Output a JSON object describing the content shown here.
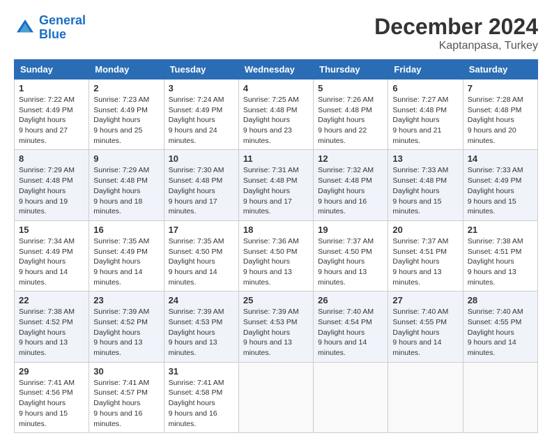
{
  "header": {
    "logo_line1": "General",
    "logo_line2": "Blue",
    "month_year": "December 2024",
    "location": "Kaptanpasa, Turkey"
  },
  "days_of_week": [
    "Sunday",
    "Monday",
    "Tuesday",
    "Wednesday",
    "Thursday",
    "Friday",
    "Saturday"
  ],
  "weeks": [
    [
      {
        "day": "1",
        "sunrise": "7:22 AM",
        "sunset": "4:49 PM",
        "daylight": "9 hours and 27 minutes."
      },
      {
        "day": "2",
        "sunrise": "7:23 AM",
        "sunset": "4:49 PM",
        "daylight": "9 hours and 25 minutes."
      },
      {
        "day": "3",
        "sunrise": "7:24 AM",
        "sunset": "4:49 PM",
        "daylight": "9 hours and 24 minutes."
      },
      {
        "day": "4",
        "sunrise": "7:25 AM",
        "sunset": "4:48 PM",
        "daylight": "9 hours and 23 minutes."
      },
      {
        "day": "5",
        "sunrise": "7:26 AM",
        "sunset": "4:48 PM",
        "daylight": "9 hours and 22 minutes."
      },
      {
        "day": "6",
        "sunrise": "7:27 AM",
        "sunset": "4:48 PM",
        "daylight": "9 hours and 21 minutes."
      },
      {
        "day": "7",
        "sunrise": "7:28 AM",
        "sunset": "4:48 PM",
        "daylight": "9 hours and 20 minutes."
      }
    ],
    [
      {
        "day": "8",
        "sunrise": "7:29 AM",
        "sunset": "4:48 PM",
        "daylight": "9 hours and 19 minutes."
      },
      {
        "day": "9",
        "sunrise": "7:29 AM",
        "sunset": "4:48 PM",
        "daylight": "9 hours and 18 minutes."
      },
      {
        "day": "10",
        "sunrise": "7:30 AM",
        "sunset": "4:48 PM",
        "daylight": "9 hours and 17 minutes."
      },
      {
        "day": "11",
        "sunrise": "7:31 AM",
        "sunset": "4:48 PM",
        "daylight": "9 hours and 17 minutes."
      },
      {
        "day": "12",
        "sunrise": "7:32 AM",
        "sunset": "4:48 PM",
        "daylight": "9 hours and 16 minutes."
      },
      {
        "day": "13",
        "sunrise": "7:33 AM",
        "sunset": "4:48 PM",
        "daylight": "9 hours and 15 minutes."
      },
      {
        "day": "14",
        "sunrise": "7:33 AM",
        "sunset": "4:49 PM",
        "daylight": "9 hours and 15 minutes."
      }
    ],
    [
      {
        "day": "15",
        "sunrise": "7:34 AM",
        "sunset": "4:49 PM",
        "daylight": "9 hours and 14 minutes."
      },
      {
        "day": "16",
        "sunrise": "7:35 AM",
        "sunset": "4:49 PM",
        "daylight": "9 hours and 14 minutes."
      },
      {
        "day": "17",
        "sunrise": "7:35 AM",
        "sunset": "4:50 PM",
        "daylight": "9 hours and 14 minutes."
      },
      {
        "day": "18",
        "sunrise": "7:36 AM",
        "sunset": "4:50 PM",
        "daylight": "9 hours and 13 minutes."
      },
      {
        "day": "19",
        "sunrise": "7:37 AM",
        "sunset": "4:50 PM",
        "daylight": "9 hours and 13 minutes."
      },
      {
        "day": "20",
        "sunrise": "7:37 AM",
        "sunset": "4:51 PM",
        "daylight": "9 hours and 13 minutes."
      },
      {
        "day": "21",
        "sunrise": "7:38 AM",
        "sunset": "4:51 PM",
        "daylight": "9 hours and 13 minutes."
      }
    ],
    [
      {
        "day": "22",
        "sunrise": "7:38 AM",
        "sunset": "4:52 PM",
        "daylight": "9 hours and 13 minutes."
      },
      {
        "day": "23",
        "sunrise": "7:39 AM",
        "sunset": "4:52 PM",
        "daylight": "9 hours and 13 minutes."
      },
      {
        "day": "24",
        "sunrise": "7:39 AM",
        "sunset": "4:53 PM",
        "daylight": "9 hours and 13 minutes."
      },
      {
        "day": "25",
        "sunrise": "7:39 AM",
        "sunset": "4:53 PM",
        "daylight": "9 hours and 13 minutes."
      },
      {
        "day": "26",
        "sunrise": "7:40 AM",
        "sunset": "4:54 PM",
        "daylight": "9 hours and 14 minutes."
      },
      {
        "day": "27",
        "sunrise": "7:40 AM",
        "sunset": "4:55 PM",
        "daylight": "9 hours and 14 minutes."
      },
      {
        "day": "28",
        "sunrise": "7:40 AM",
        "sunset": "4:55 PM",
        "daylight": "9 hours and 14 minutes."
      }
    ],
    [
      {
        "day": "29",
        "sunrise": "7:41 AM",
        "sunset": "4:56 PM",
        "daylight": "9 hours and 15 minutes."
      },
      {
        "day": "30",
        "sunrise": "7:41 AM",
        "sunset": "4:57 PM",
        "daylight": "9 hours and 16 minutes."
      },
      {
        "day": "31",
        "sunrise": "7:41 AM",
        "sunset": "4:58 PM",
        "daylight": "9 hours and 16 minutes."
      },
      null,
      null,
      null,
      null
    ]
  ]
}
